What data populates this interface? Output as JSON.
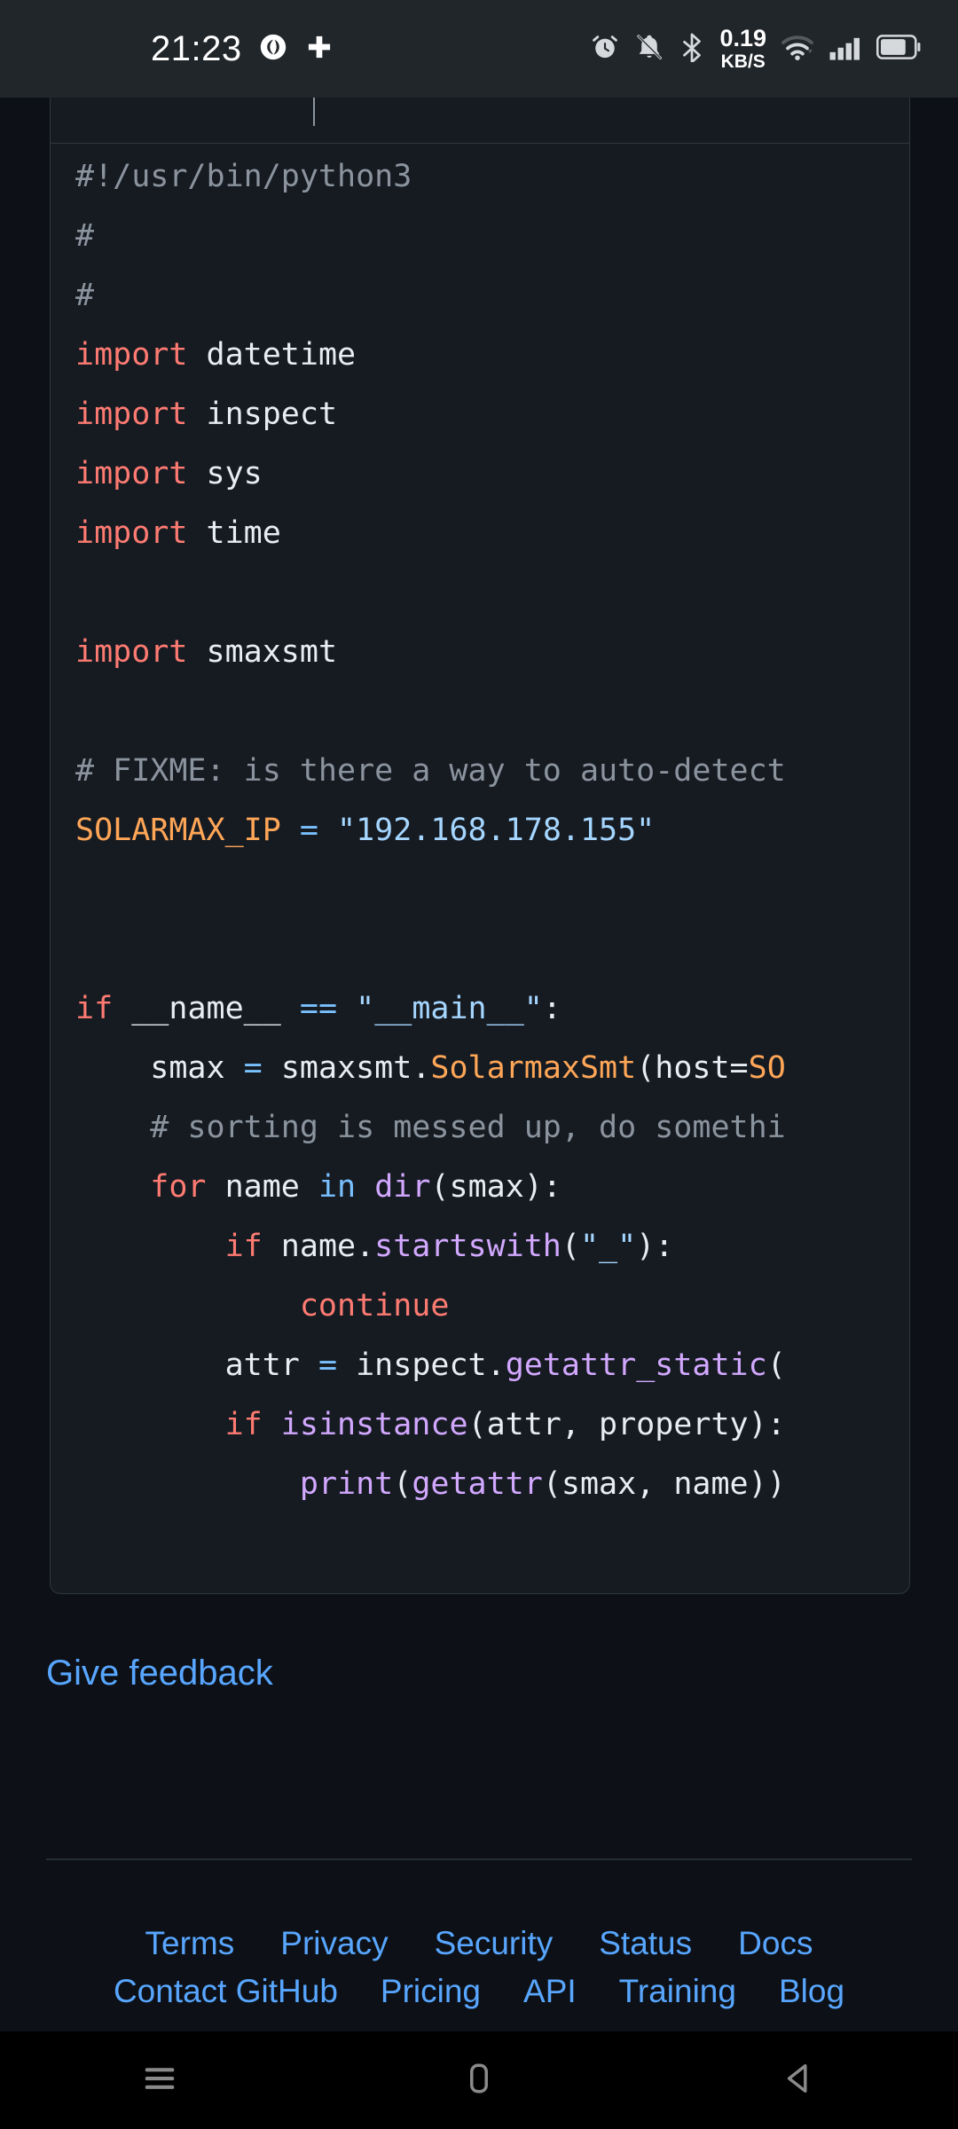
{
  "status_bar": {
    "clock": "21:23",
    "net_speed_rate": "0.19",
    "net_speed_unit": "KB/S",
    "icons_left": [
      "app-glyph-icon",
      "medical-cross-icon"
    ],
    "icons_right": [
      "alarm-clock-icon",
      "bell-muted-icon",
      "bluetooth-icon",
      "wifi-icon",
      "cellular-signal-icon",
      "battery-icon"
    ],
    "background": "#21262b"
  },
  "code_block": {
    "language": "python",
    "theme_colors": {
      "background": "#161b22",
      "border": "#30363d",
      "text": "#e6edf3",
      "comment": "#8b949e",
      "keyword": "#ff7b72",
      "variable": "#ffa657",
      "operator": "#79c0ff",
      "string": "#a5d6ff",
      "function": "#d2a8ff"
    },
    "lines": [
      "#!/usr/bin/python3",
      "#",
      "#",
      "import datetime",
      "import inspect",
      "import sys",
      "import time",
      "",
      "import smaxsmt",
      "",
      "# FIXME: is there a way to auto-detect",
      "SOLARMAX_IP = \"192.168.178.155\"",
      "",
      "",
      "if __name__ == \"__main__\":",
      "    smax = smaxsmt.SolarmaxSmt(host=SO",
      "    # sorting is messed up, do somethi",
      "    for name in dir(smax):",
      "        if name.startswith(\"_\"):",
      "            continue",
      "        attr = inspect.getattr_static(",
      "        if isinstance(attr, property):",
      "            print(getattr(smax, name))"
    ]
  },
  "feedback": {
    "label": "Give feedback",
    "color": "#58a6ff"
  },
  "footer": {
    "row1": [
      "Terms",
      "Privacy",
      "Security",
      "Status",
      "Docs"
    ],
    "row2": [
      "Contact GitHub",
      "Pricing",
      "API",
      "Training",
      "Blog"
    ],
    "link_color": "#58a6ff"
  },
  "nav_bar": {
    "buttons": [
      "recents-button",
      "home-button",
      "back-button"
    ],
    "background": "#000000",
    "icon_color": "#8a8a8a"
  }
}
